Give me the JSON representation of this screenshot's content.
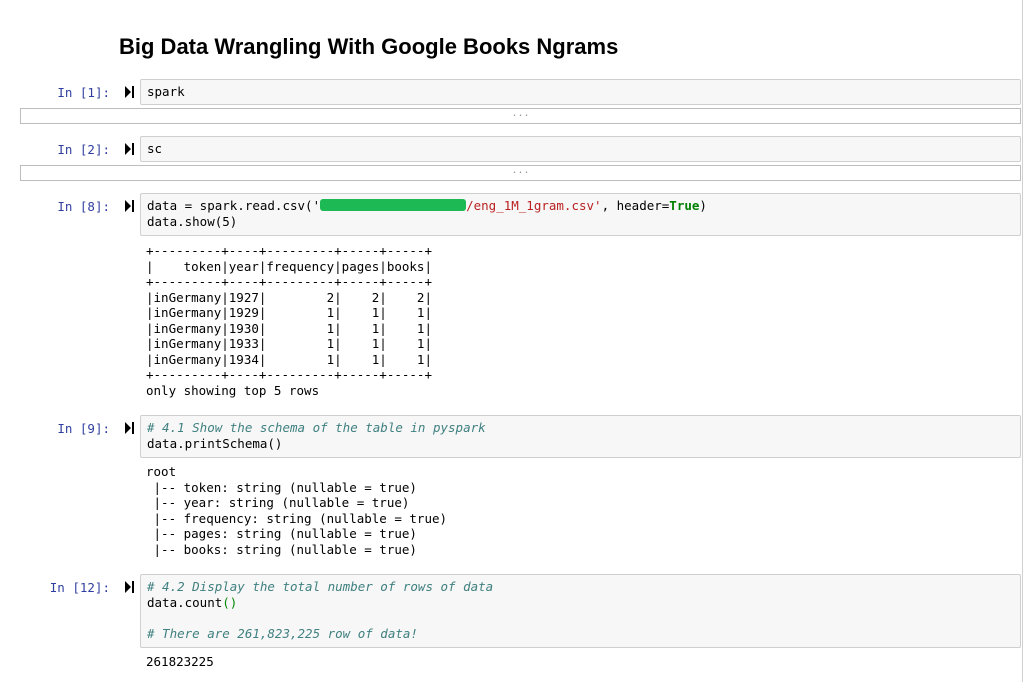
{
  "notebook": {
    "title": "Big Data Wrangling With Google Books Ngrams",
    "collapsed_label": "...",
    "cells": [
      {
        "prompt": "In [1]:",
        "code": [
          "spark"
        ]
      },
      {
        "prompt": "In [2]:",
        "code": [
          "sc"
        ]
      },
      {
        "prompt": "In [8]:",
        "code_line1_pre": "data = spark.read.csv('",
        "code_line1_str_end": "/eng_1M_1gram.csv'",
        "code_line1_post": ", header=",
        "code_line1_kw": "True",
        "code_line1_close": ")",
        "code_line2": "data.show(5)",
        "output": [
          "+---------+----+---------+-----+-----+",
          "|    token|year|frequency|pages|books|",
          "+---------+----+---------+-----+-----+",
          "|inGermany|1927|        2|    2|    2|",
          "|inGermany|1929|        1|    1|    1|",
          "|inGermany|1930|        1|    1|    1|",
          "|inGermany|1933|        1|    1|    1|",
          "|inGermany|1934|        1|    1|    1|",
          "+---------+----+---------+-----+-----+",
          "only showing top 5 rows"
        ]
      },
      {
        "prompt": "In [9]:",
        "comment": "# 4.1 Show the schema of the table in pyspark",
        "code_line2": "data.printSchema()",
        "output": [
          "root",
          " |-- token: string (nullable = true)",
          " |-- year: string (nullable = true)",
          " |-- frequency: string (nullable = true)",
          " |-- pages: string (nullable = true)",
          " |-- books: string (nullable = true)"
        ]
      },
      {
        "prompt": "In [12]:",
        "comment": "# 4.2 Display the total number of rows of data",
        "code_line2_pre": "data.count",
        "code_line2_parens": "()",
        "comment2": "# There are 261,823,225 row of data!",
        "output": [
          "261823225"
        ]
      }
    ]
  }
}
